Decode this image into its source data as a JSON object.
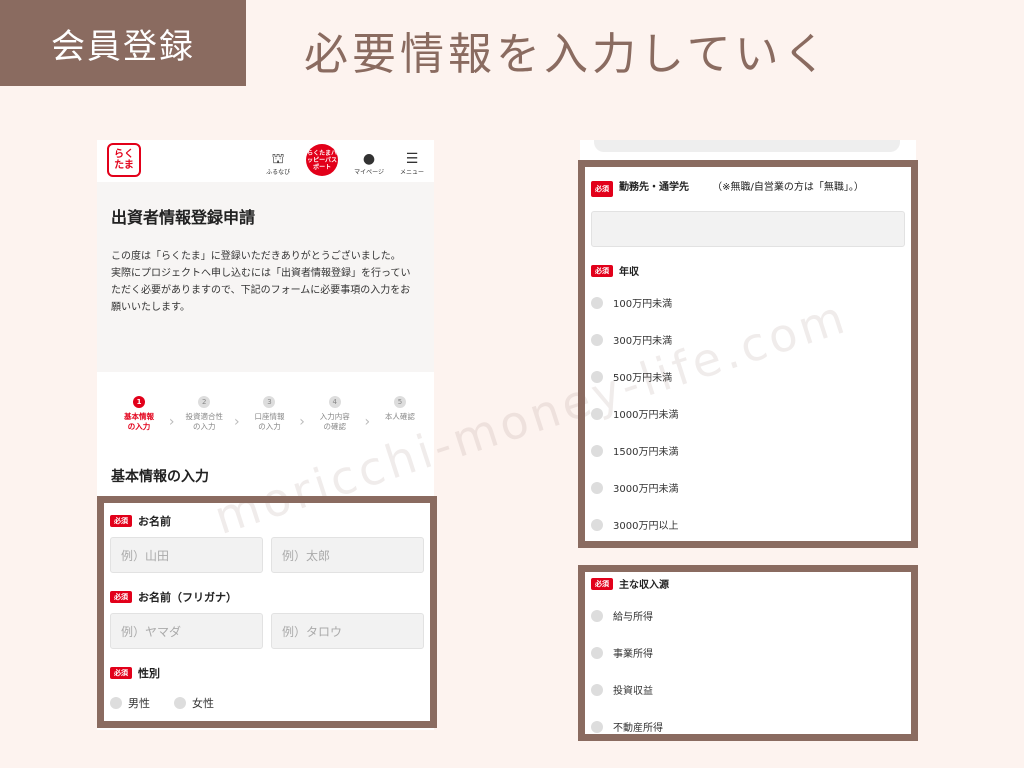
{
  "header": {
    "tag": "会員登録",
    "title": "必要情報を入力していく"
  },
  "watermark": "moricchi-money-life.com",
  "app": {
    "logo": [
      "らく",
      "たま"
    ],
    "nav": [
      {
        "icon": "furunavi-icon",
        "label": "ふるなび"
      },
      {
        "icon": "passport-icon",
        "label": "らくたまハッピーパスポート"
      },
      {
        "icon": "user-icon",
        "label": "マイページ"
      },
      {
        "icon": "menu-icon",
        "label": "メニュー"
      }
    ]
  },
  "intro": {
    "title": "出資者情報登録申請",
    "p1": "この度は「らくたま」に登録いただきありがとうございました。",
    "p2": "実際にプロジェクトへ申し込むには「出資者情報登録」を行っていただく必要がありますので、下記のフォームに必要事項の入力をお願いいたします。"
  },
  "steps": [
    {
      "n": "1",
      "l1": "基本情報",
      "l2": "の入力"
    },
    {
      "n": "2",
      "l1": "投資適合性",
      "l2": "の入力"
    },
    {
      "n": "3",
      "l1": "口座情報",
      "l2": "の入力"
    },
    {
      "n": "4",
      "l1": "入力内容",
      "l2": "の確認"
    },
    {
      "n": "5",
      "l1": "本人確認",
      "l2": ""
    }
  ],
  "section_title": "基本情報の入力",
  "required": "必須",
  "form": {
    "name_label": "お名前",
    "name_last_ph": "例）山田",
    "name_first_ph": "例）太郎",
    "kana_label": "お名前（フリガナ）",
    "kana_last_ph": "例）ヤマダ",
    "kana_first_ph": "例）タロウ",
    "gender_label": "性別",
    "male": "男性",
    "female": "女性"
  },
  "right": {
    "employer_label": "勤務先・通学先",
    "employer_note": "（※無職/自営業の方は「無職」。）",
    "income_label": "年収",
    "income_options": [
      "100万円未満",
      "300万円未満",
      "500万円未満",
      "1000万円未満",
      "1500万円未満",
      "3000万円未満",
      "3000万円以上"
    ],
    "source_label": "主な収入源",
    "source_options": [
      "給与所得",
      "事業所得",
      "投資収益",
      "不動産所得"
    ]
  }
}
